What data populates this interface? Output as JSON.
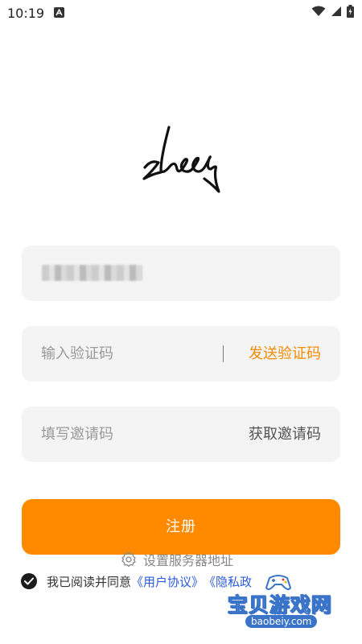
{
  "status_bar": {
    "time": "10:19",
    "icons": [
      "notification-a-icon",
      "wifi-icon",
      "signal-icon",
      "battery-icon"
    ]
  },
  "logo": {
    "icon": "zleep-logo"
  },
  "phone_field": {
    "value_masked": true
  },
  "code_field": {
    "placeholder": "输入验证码",
    "action_label": "发送验证码",
    "action_color": "#f28c00"
  },
  "invite_field": {
    "placeholder": "填写邀请码",
    "action_label": "获取邀请码"
  },
  "register_button": {
    "label": "注册",
    "color": "#ff8a00"
  },
  "server": {
    "label": "设置服务器地址",
    "icon": "gear-icon"
  },
  "agreement": {
    "checked": true,
    "text": "我已阅读并同意",
    "user_agreement": "《用户协议》",
    "privacy_policy": "《隐私政"
  },
  "watermark": {
    "title": "宝贝游戏网",
    "url": "baobeiy.com"
  }
}
